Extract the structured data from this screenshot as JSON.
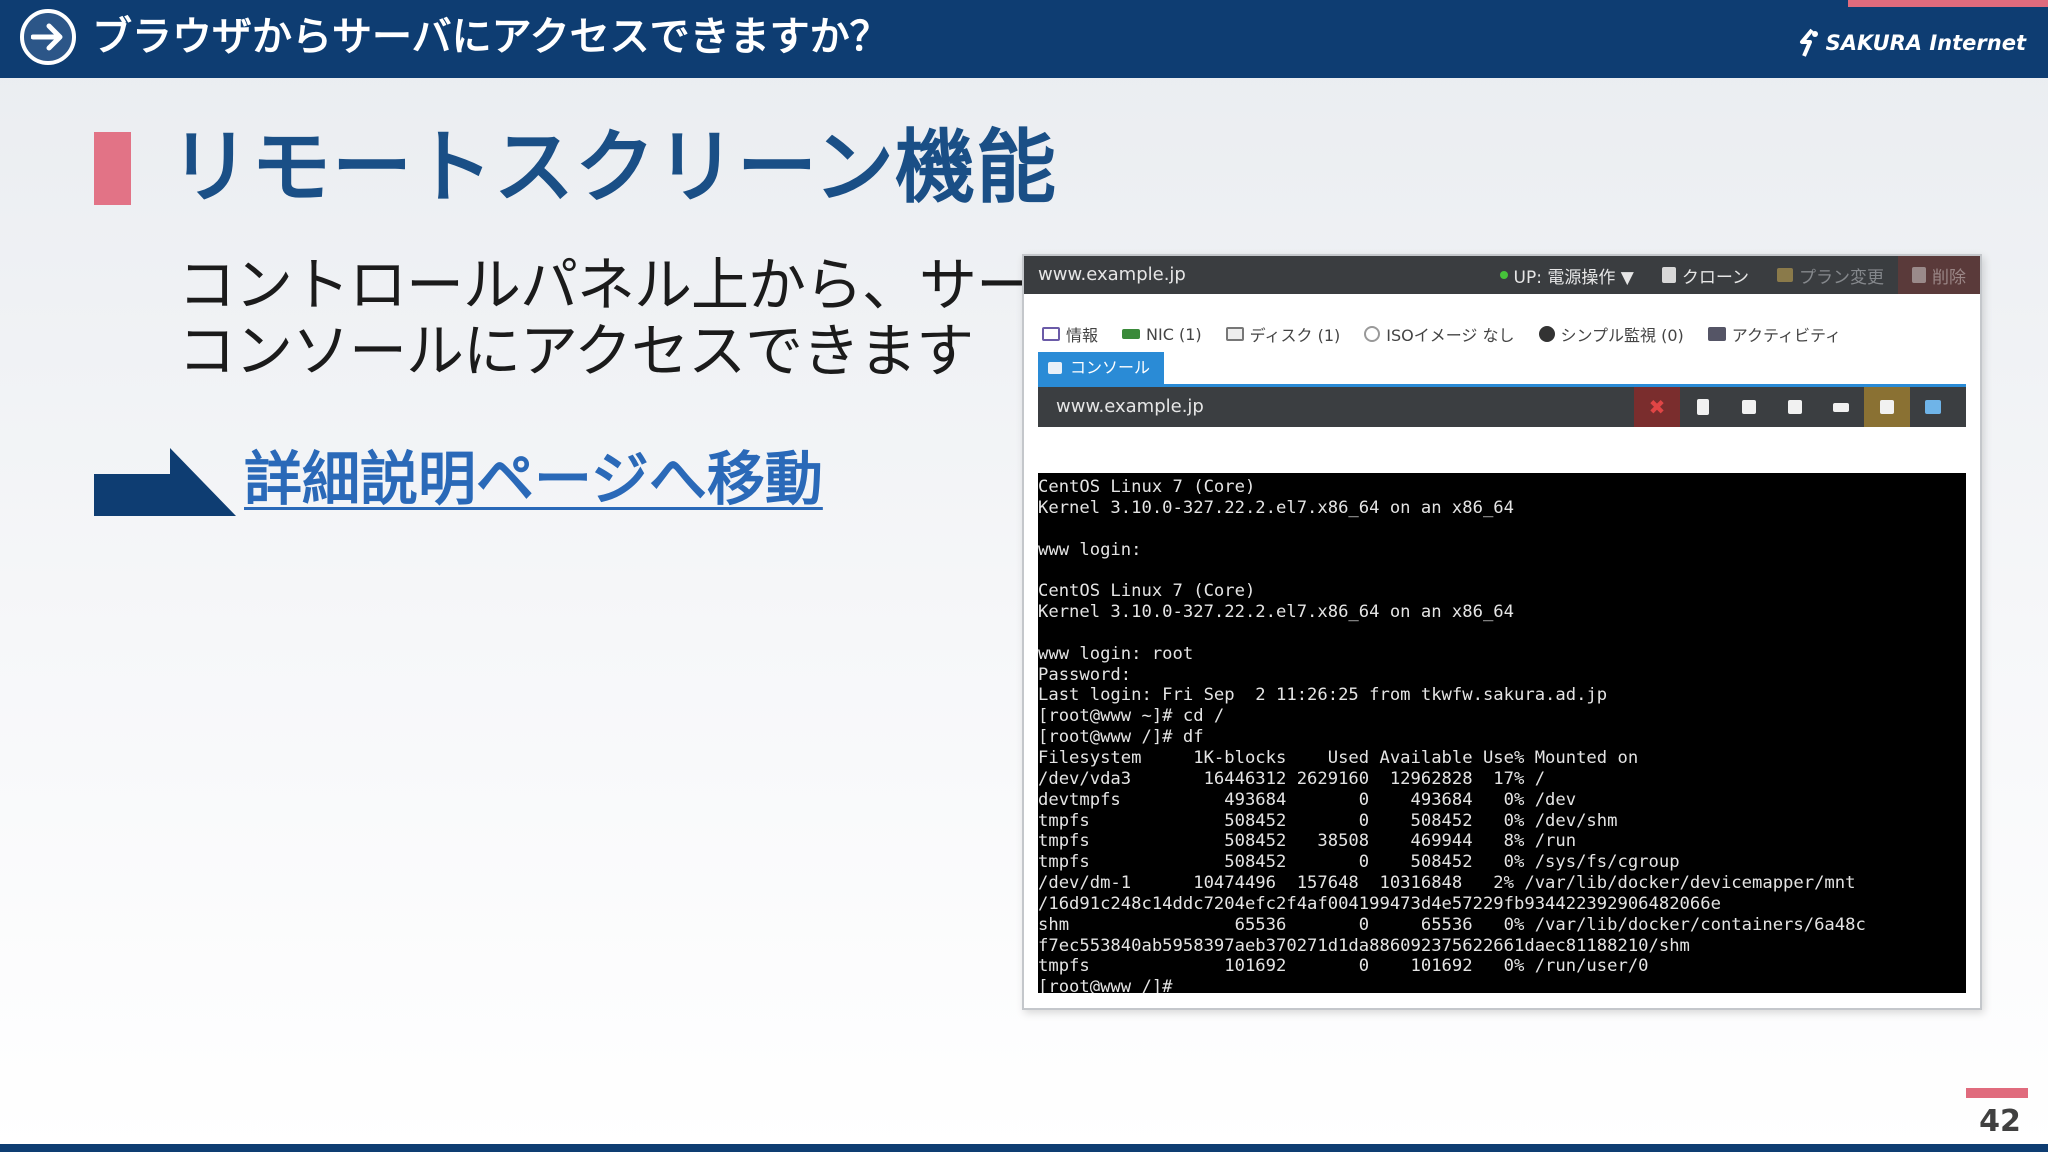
{
  "header": {
    "title": "ブラウザからサーバにアクセスできますか？",
    "logo_text": "SAKURA Internet"
  },
  "slide": {
    "section_title": "リモートスクリーン機能",
    "description_lines": [
      "コントロールパネル上から、サーバの",
      "コンソールにアクセスできます"
    ],
    "link_text": "詳細説明ページへ移動",
    "page_number": "42"
  },
  "panel": {
    "host": "www.example.jp",
    "actions": {
      "power": "UP: 電源操作 ▼",
      "clone": "クローン",
      "plan_change": "プラン変更",
      "delete": "削除"
    },
    "tabs": [
      "情報",
      "NIC (1)",
      "ディスク (1)",
      "ISOイメージ なし",
      "シンプル監視 (0)",
      "アクティビティ"
    ],
    "active_tab": "コンソール",
    "console_host": "www.example.jp",
    "terminal_lines": [
      "CentOS Linux 7 (Core)",
      "Kernel 3.10.0-327.22.2.el7.x86_64 on an x86_64",
      "",
      "www login:",
      "",
      "CentOS Linux 7 (Core)",
      "Kernel 3.10.0-327.22.2.el7.x86_64 on an x86_64",
      "",
      "www login: root",
      "Password:",
      "Last login: Fri Sep  2 11:26:25 from tkwfw.sakura.ad.jp",
      "[root@www ~]# cd /",
      "[root@www /]# df",
      "Filesystem     1K-blocks    Used Available Use% Mounted on",
      "/dev/vda3       16446312 2629160  12962828  17% /",
      "devtmpfs          493684       0    493684   0% /dev",
      "tmpfs             508452       0    508452   0% /dev/shm",
      "tmpfs             508452   38508    469944   8% /run",
      "tmpfs             508452       0    508452   0% /sys/fs/cgroup",
      "/dev/dm-1      10474496  157648  10316848   2% /var/lib/docker/devicemapper/mnt",
      "/16d91c248c14ddc7204efc2f4af004199473d4e57229fb934422392906482066e",
      "shm                65536       0     65536   0% /var/lib/docker/containers/6a48c",
      "f7ec553840ab5958397aeb370271d1da886092375622661daec81188210/shm",
      "tmpfs             101692       0    101692   0% /run/user/0",
      "[root@www /]# _"
    ]
  }
}
